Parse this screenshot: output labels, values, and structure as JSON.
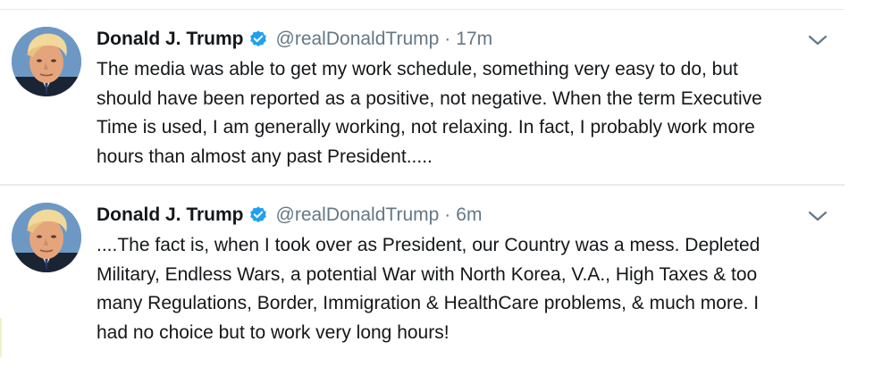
{
  "tweets": [
    {
      "name": "Donald J. Trump",
      "verified_icon": "verified-badge-icon",
      "handle": "@realDonaldTrump",
      "separator": "·",
      "time": "17m",
      "text": "The media was able to get my work schedule, something very easy to do, but\nshould have been reported as a positive, not negative. When the term Executive\nTime is used, I am generally working, not relaxing. In fact, I probably work more\nhours than almost any past President....."
    },
    {
      "name": "Donald J. Trump",
      "verified_icon": "verified-badge-icon",
      "handle": "@realDonaldTrump",
      "separator": "·",
      "time": "6m",
      "text": "....The fact is, when I took over as President, our Country was a mess. Depleted\nMilitary, Endless Wars, a potential War with North Korea, V.A., High Taxes & too\nmany Regulations, Border, Immigration & HealthCare problems, & much more. I\nhad no choice but to work very long hours!"
    }
  ],
  "colors": {
    "verified": "#1da1f2",
    "muted": "#657786",
    "text": "#14171a",
    "divider": "#e6ecf0"
  }
}
